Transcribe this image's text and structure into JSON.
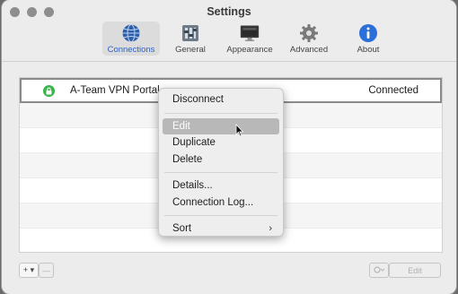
{
  "window": {
    "title": "Settings"
  },
  "toolbar": {
    "items": [
      {
        "label": "Connections",
        "icon": "globe-icon",
        "selected": true
      },
      {
        "label": "General",
        "icon": "switches-icon"
      },
      {
        "label": "Appearance",
        "icon": "monitor-icon"
      },
      {
        "label": "Advanced",
        "icon": "gear-icon"
      },
      {
        "label": "About",
        "icon": "info-icon"
      }
    ]
  },
  "connections": {
    "rows": [
      {
        "name": "A-Team VPN Portal",
        "status": "Connected",
        "icon": "lock-icon"
      }
    ]
  },
  "context_menu": {
    "items": {
      "disconnect": "Disconnect",
      "edit": "Edit",
      "duplicate": "Duplicate",
      "delete": "Delete",
      "details": "Details...",
      "connection_log": "Connection Log...",
      "sort": "Sort"
    },
    "highlighted": "Edit"
  },
  "bottom_bar": {
    "add_label": "+ ▾",
    "remove_label": "—",
    "edit_label": "Edit"
  }
}
